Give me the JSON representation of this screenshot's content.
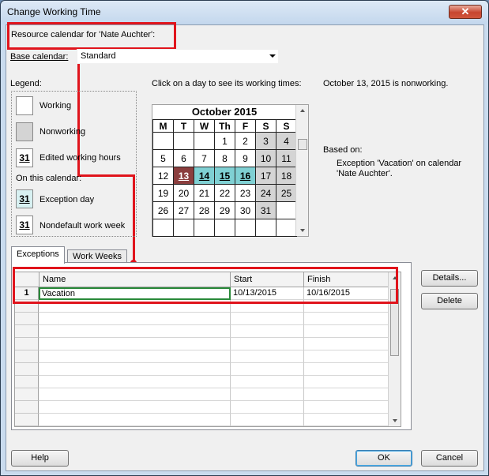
{
  "window": {
    "title": "Change Working Time",
    "close_glyph": "✕"
  },
  "resource_label": "Resource calendar for 'Nate Auchter':",
  "base_calendar": {
    "label": "Base calendar:",
    "value": "Standard"
  },
  "legend": {
    "heading": "Legend:",
    "working": "Working",
    "nonworking": "Nonworking",
    "edited": "Edited working hours",
    "edited_num": "31",
    "on_this_calendar": "On this calendar:",
    "exception": "Exception day",
    "exception_num": "31",
    "nondefault": "Nondefault work week",
    "nondefault_num": "31"
  },
  "calendar": {
    "prompt": "Click on a day to see its working times:",
    "month": "October 2015",
    "weekdays": [
      "M",
      "T",
      "W",
      "Th",
      "F",
      "S",
      "S"
    ],
    "weeks": [
      [
        "",
        "",
        "",
        "1",
        "2",
        "3",
        "4"
      ],
      [
        "5",
        "6",
        "7",
        "8",
        "9",
        "10",
        "11"
      ],
      [
        "12",
        "13",
        "14",
        "15",
        "16",
        "17",
        "18"
      ],
      [
        "19",
        "20",
        "21",
        "22",
        "23",
        "24",
        "25"
      ],
      [
        "26",
        "27",
        "28",
        "29",
        "30",
        "31",
        ""
      ],
      [
        "",
        "",
        "",
        "",
        "",
        "",
        ""
      ]
    ]
  },
  "info": {
    "status": "October 13, 2015 is nonworking.",
    "based_on": "Based on:",
    "detail_line1": "Exception 'Vacation' on calendar",
    "detail_line2": "'Nate Auchter'."
  },
  "tabs": [
    "Exceptions",
    "Work Weeks"
  ],
  "exceptions_table": {
    "columns": [
      "Name",
      "Start",
      "Finish"
    ],
    "rows": [
      {
        "id": "1",
        "name": "Vacation",
        "start": "10/13/2015",
        "finish": "10/16/2015"
      }
    ]
  },
  "buttons": {
    "details": "Details...",
    "delete": "Delete",
    "help": "Help",
    "ok": "OK",
    "cancel": "Cancel"
  },
  "colors": {
    "highlight": "#e0141c",
    "nonworking": "#d4d4d4",
    "exception": "#7fd0d3",
    "selected": "#8b3e3e"
  }
}
